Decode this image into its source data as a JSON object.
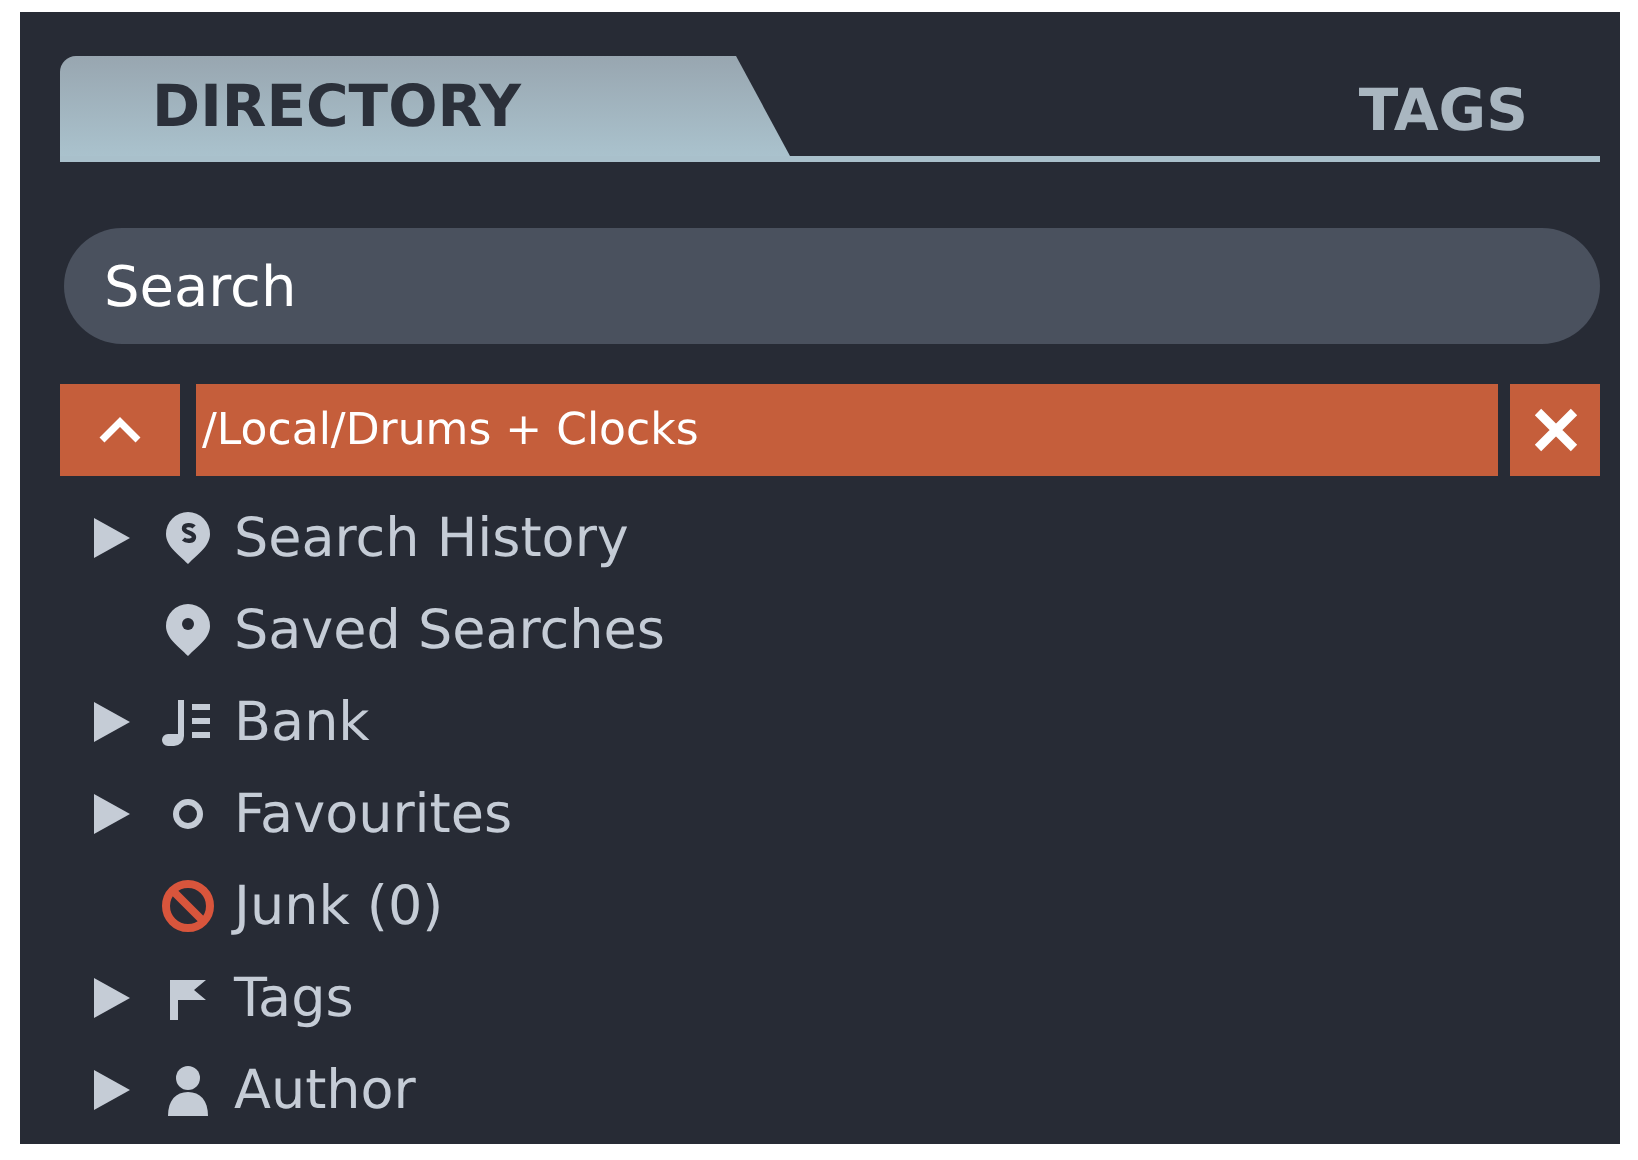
{
  "tabs": [
    {
      "label": "DIRECTORY",
      "selected": true
    },
    {
      "label": "TAGS",
      "selected": false
    }
  ],
  "search": {
    "placeholder": "Search"
  },
  "path_bar": {
    "path": "/Local/Drums + Clocks"
  },
  "tree": [
    {
      "label": "Search History",
      "kind": "history",
      "expandable": true
    },
    {
      "label": "Saved Searches",
      "kind": "pin",
      "expandable": false
    },
    {
      "label": "Bank",
      "kind": "bank",
      "expandable": true
    },
    {
      "label": "Favourites",
      "kind": "favourite",
      "expandable": true
    },
    {
      "label": "Junk (0)",
      "kind": "junk",
      "expandable": false
    },
    {
      "label": "Tags",
      "kind": "flag",
      "expandable": true
    },
    {
      "label": "Author",
      "kind": "person",
      "expandable": true
    }
  ]
}
